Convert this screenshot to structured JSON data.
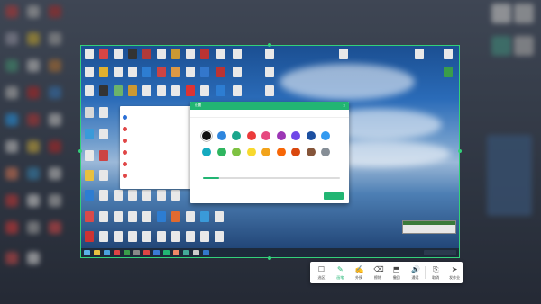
{
  "file_panel": {
    "header": "",
    "items": [
      {
        "name": "",
        "meta": "",
        "color": "#2b6fd6"
      },
      {
        "name": "",
        "meta": "",
        "color": "#e04646"
      },
      {
        "name": "",
        "meta": "",
        "color": "#e04646"
      },
      {
        "name": "",
        "meta": "",
        "color": "#e04646"
      },
      {
        "name": "",
        "meta": "",
        "color": "#e04646"
      },
      {
        "name": "",
        "meta": "",
        "color": "#e04646"
      }
    ],
    "footer": ""
  },
  "dialog": {
    "title": "设置",
    "close_glyph": "×",
    "tabs": [
      {
        "label": "",
        "active": true
      },
      {
        "label": "",
        "active": false
      }
    ],
    "color_section_label": "",
    "colors_row1": [
      "#111111",
      "#2e86de",
      "#1ba68c",
      "#eb3b3b",
      "#e64980",
      "#9c36b5",
      "#7048e8",
      "#1c4fa0",
      "#339af0"
    ],
    "colors_row2": [
      "#15aabf",
      "#2fb55f",
      "#7ec242",
      "#f8d92f",
      "#f2a31b",
      "#f76707",
      "#d9480f",
      "#85553a",
      "#868e96"
    ],
    "selected_color": "#111111",
    "size_section_label": "",
    "size_value": 0.12,
    "confirm_label": ""
  },
  "mini_window": {
    "title": ""
  },
  "toolbar": {
    "tools": [
      {
        "icon": "☐",
        "label": "选区",
        "active": false
      },
      {
        "icon": "✎",
        "label": "画笔",
        "active": true
      },
      {
        "icon": "✍",
        "label": "外摸",
        "active": false
      },
      {
        "icon": "⌫",
        "label": "擦除",
        "active": false
      },
      {
        "icon": "⬒",
        "label": "撤回",
        "active": false
      },
      {
        "icon": "🔊",
        "label": "通话",
        "active": false
      },
      {
        "icon": "⎘",
        "label": "取消",
        "active": false
      },
      {
        "icon": "➤",
        "label": "发作业",
        "active": false
      }
    ]
  }
}
